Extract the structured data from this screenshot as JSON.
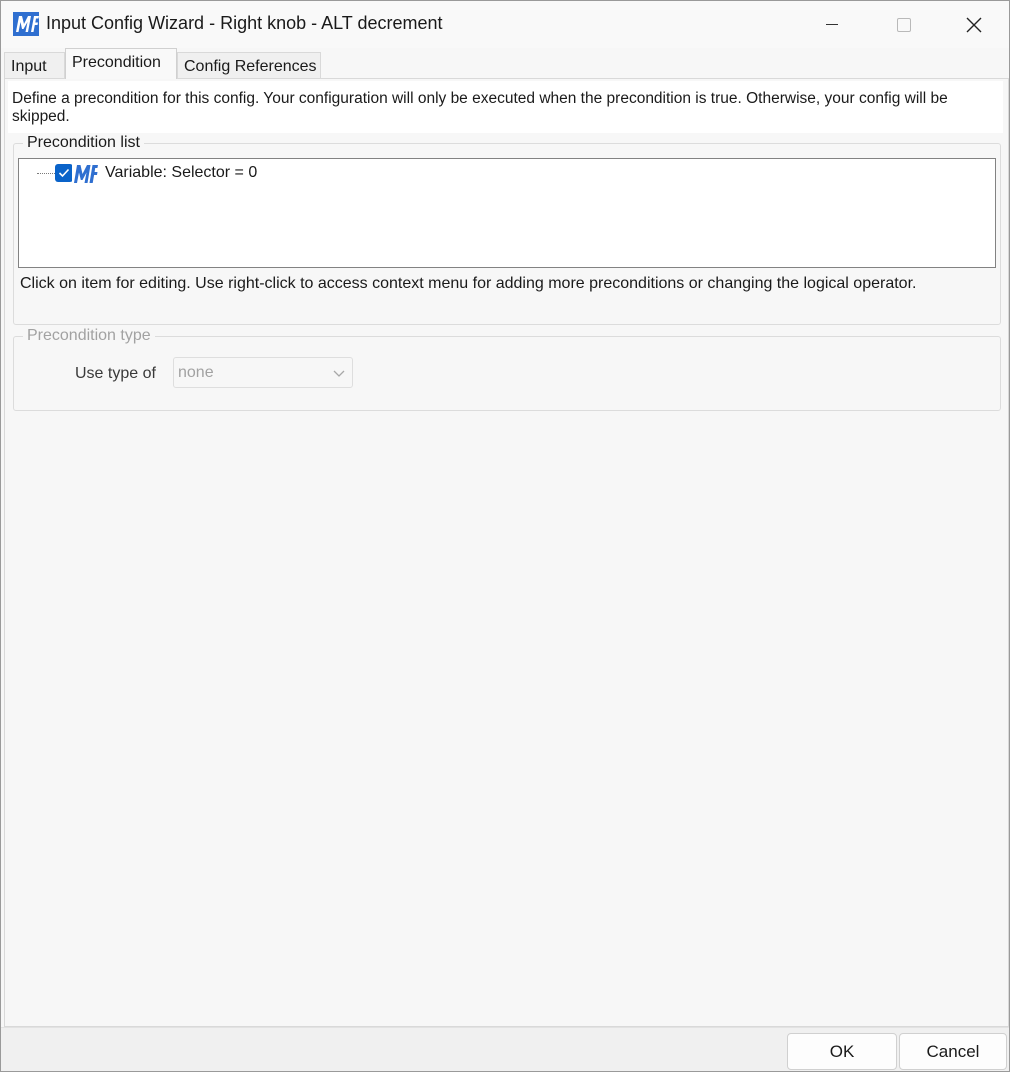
{
  "window": {
    "title": "Input Config Wizard - Right knob - ALT decrement",
    "app_icon": "mf-logo-icon",
    "controls": {
      "minimize": "minimize-icon",
      "maximize": "maximize-icon",
      "close": "close-icon"
    }
  },
  "tabs": [
    {
      "label": "Input",
      "selected": false
    },
    {
      "label": "Precondition",
      "selected": true
    },
    {
      "label": "Config References",
      "selected": false
    }
  ],
  "description": "Define a precondition for this config. Your configuration will only be executed when the precondition is true. Otherwise, your config will be skipped.",
  "precondition_list": {
    "legend": "Precondition list",
    "items": [
      {
        "label": "Variable: Selector = 0",
        "checked": true,
        "icon": "mf-logo-icon"
      }
    ],
    "hint": "Click on item for editing. Use right-click to access context menu for adding more preconditions or changing the logical operator."
  },
  "precondition_type": {
    "legend": "Precondition type",
    "enabled": false,
    "use_type_label": "Use type of",
    "selected_value": "none"
  },
  "buttons": {
    "ok": "OK",
    "cancel": "Cancel"
  },
  "colors": {
    "accent": "#0a63c9",
    "logo_blue": "#2f6fd0",
    "disabled_text": "#a2a2a2"
  }
}
